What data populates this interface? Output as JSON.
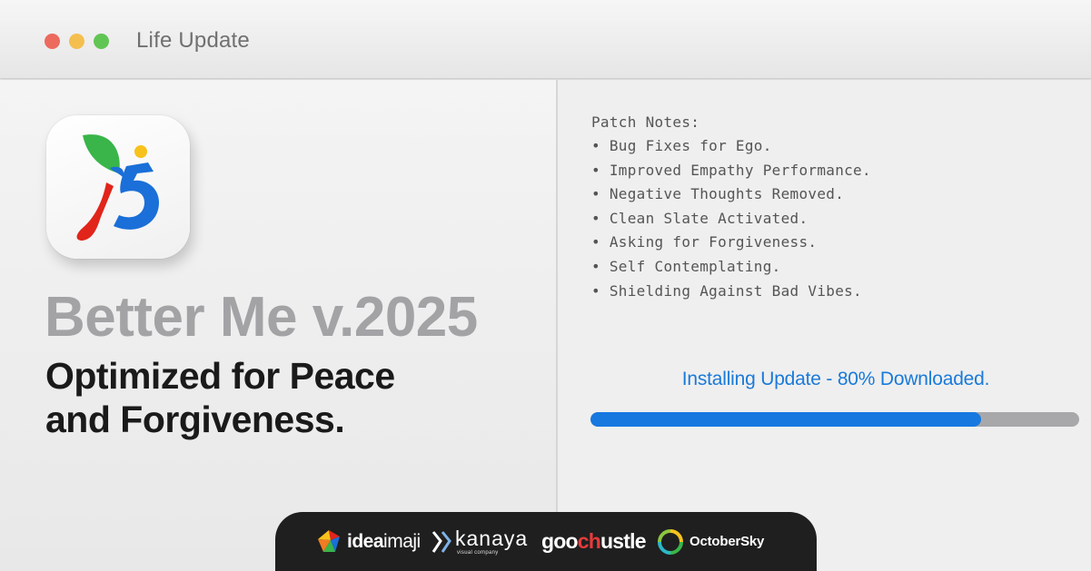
{
  "window": {
    "title": "Life Update",
    "controls": {
      "close": "#ec6a5e",
      "minimize": "#f4bf4f",
      "zoom": "#61c554"
    }
  },
  "app": {
    "icon": "ios15-logo-icon",
    "name": "Better Me v.2025",
    "tagline_line1": "Optimized for Peace",
    "tagline_line2": "and Forgiveness."
  },
  "patch_notes": {
    "heading": "Patch Notes:",
    "items": [
      "Bug Fixes for Ego.",
      "Improved Empathy Performance.",
      "Negative Thoughts Removed.",
      "Clean Slate Activated.",
      "Asking for Forgiveness.",
      "Self Contemplating.",
      "Shielding Against Bad Vibes."
    ]
  },
  "install": {
    "status": "Installing Update - 80% Downloaded.",
    "progress_percent": 80
  },
  "sponsors": {
    "ideaimaji": {
      "bold": "idea",
      "light": "imaji"
    },
    "kanaya": {
      "name": "kanaya",
      "sub": "visual company"
    },
    "goochustle": {
      "part1": "goo",
      "accent": "ch",
      "part2": "ustle"
    },
    "octobersky": {
      "name": "OctoberSky"
    }
  },
  "colors": {
    "accent_blue": "#1a7ad9",
    "progress_fill": "#1778e0",
    "progress_track": "#a8a8ab"
  }
}
